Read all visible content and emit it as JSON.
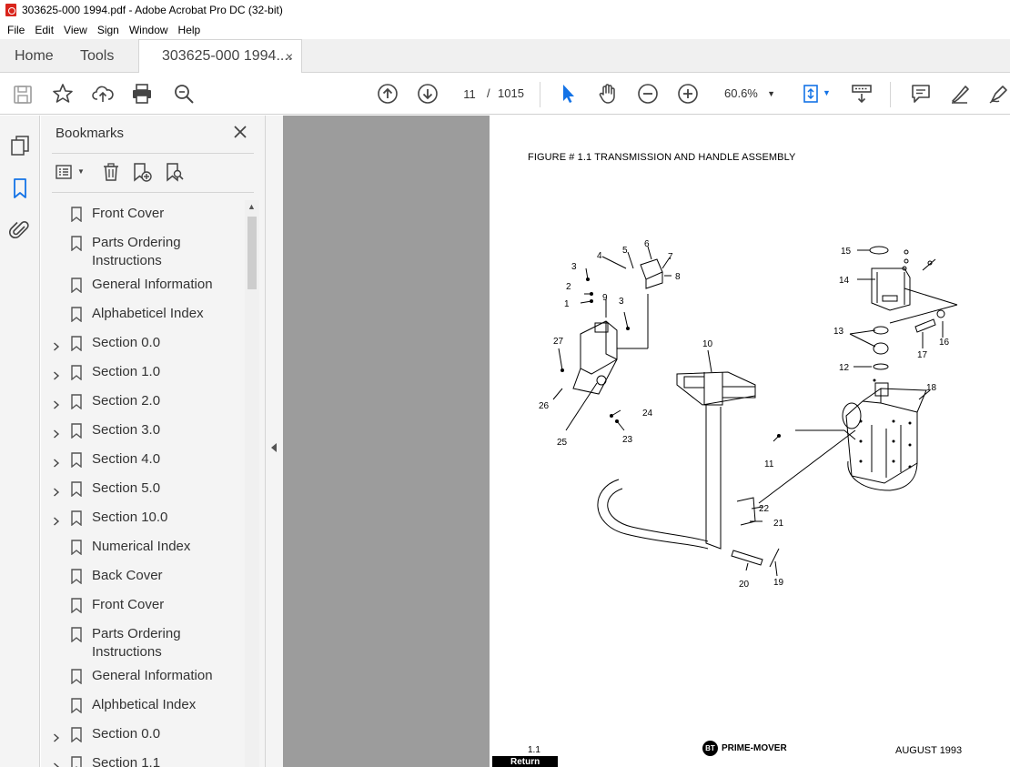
{
  "window": {
    "title": "303625-000 1994.pdf - Adobe Acrobat Pro DC (32-bit)"
  },
  "menu": [
    "File",
    "Edit",
    "View",
    "Sign",
    "Window",
    "Help"
  ],
  "tabs": {
    "home": "Home",
    "tools": "Tools",
    "document": "303625-000 1994....",
    "close": "×"
  },
  "toolbar": {
    "current_page": "11",
    "page_separator": "/",
    "total_pages": "1015",
    "zoom": "60.6%"
  },
  "bookmarks": {
    "title": "Bookmarks",
    "items": [
      {
        "label": "Front Cover",
        "expandable": false
      },
      {
        "label": "Parts Ordering Instructions",
        "expandable": false
      },
      {
        "label": "General Information",
        "expandable": false
      },
      {
        "label": "Alphabeticel Index",
        "expandable": false
      },
      {
        "label": "Section 0.0",
        "expandable": true
      },
      {
        "label": "Section 1.0",
        "expandable": true
      },
      {
        "label": "Section 2.0",
        "expandable": true
      },
      {
        "label": "Section 3.0",
        "expandable": true
      },
      {
        "label": "Section 4.0",
        "expandable": true
      },
      {
        "label": "Section 5.0",
        "expandable": true
      },
      {
        "label": "Section 10.0",
        "expandable": true
      },
      {
        "label": "Numerical Index",
        "expandable": false
      },
      {
        "label": "Back Cover",
        "expandable": false
      },
      {
        "label": "Front Cover",
        "expandable": false
      },
      {
        "label": "Parts Ordering Instructions",
        "expandable": false
      },
      {
        "label": "General Information",
        "expandable": false
      },
      {
        "label": "Alphbetical Index",
        "expandable": false
      },
      {
        "label": "Section 0.0",
        "expandable": true
      },
      {
        "label": "Section 1.1",
        "expandable": true
      }
    ]
  },
  "document": {
    "figure_title": "FIGURE # 1.1  TRANSMISSION AND HANDLE ASSEMBLY",
    "callouts": [
      "1",
      "2",
      "3",
      "4",
      "5",
      "6",
      "7",
      "8",
      "3",
      "9",
      "10",
      "11",
      "12",
      "13",
      "14",
      "15",
      "16",
      "17",
      "18",
      "19",
      "20",
      "21",
      "22",
      "23",
      "24",
      "25",
      "26",
      "27"
    ],
    "footer_page": "1.1",
    "footer_return": "Return",
    "logo_mark": "BT",
    "brand": "PRIME-MOVER",
    "date": "AUGUST 1993"
  },
  "colors": {
    "doc_background": "#9c9c9c",
    "panel_background": "#f4f4f4",
    "accent": "#1473e6",
    "pdf_icon": "#d9251c"
  }
}
